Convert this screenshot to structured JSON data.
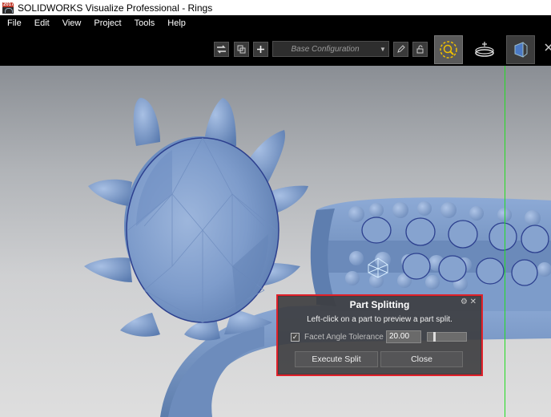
{
  "window": {
    "title": "SOLIDWORKS Visualize Professional - Rings",
    "icon": "app-icon"
  },
  "menu": [
    "File",
    "Edit",
    "View",
    "Project",
    "Tools",
    "Help"
  ],
  "toolbar": {
    "configuration": "Base Configuration",
    "icons": [
      "swap-icon",
      "copy-icon",
      "plus-icon",
      "pencil-icon",
      "lock-icon",
      "zoom-select-icon",
      "turntable-icon",
      "camera-view-icon",
      "close-icon"
    ]
  },
  "dialog": {
    "title": "Part Splitting",
    "hint": "Left-click on a part to preview a part split.",
    "checkbox_checked": true,
    "checkbox_label": "Facet Angle Tolerance",
    "tolerance_value": "20.00",
    "slider_level": 0.08,
    "execute_label": "Execute Split",
    "close_label": "Close",
    "highlight_color": "#e0212a"
  },
  "colors": {
    "model": "#7a9bc9",
    "selection_outline": "#2c3f8e",
    "axis_line": "#22dd22"
  }
}
